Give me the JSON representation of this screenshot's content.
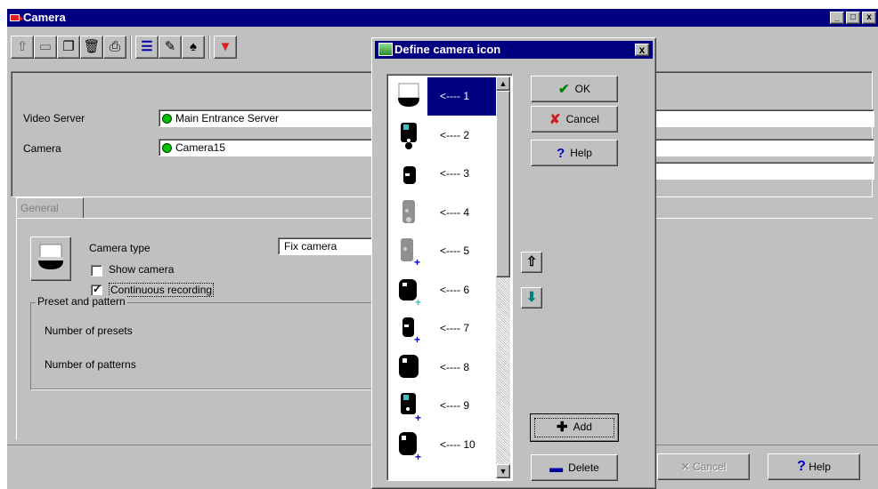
{
  "main_window": {
    "title": "Camera",
    "window_controls": [
      "_",
      "□",
      "x"
    ],
    "toolbar_icons": [
      "up-arrow-icon",
      "save-icon",
      "copy-icon",
      "delete-icon",
      "print-icon",
      "list-icon",
      "pen-icon",
      "binoculars-icon",
      "tool-icon"
    ],
    "video_server_label": "Video Server",
    "video_server_value": "Main Entrance Server",
    "camera_label": "Camera",
    "camera_value": "Camera15",
    "tab_general": "General",
    "camera_type_label": "Camera type",
    "camera_type_value": "Fix camera",
    "show_camera_label": "Show camera",
    "show_camera_checked": false,
    "continuous_recording_label": "Continuous recording",
    "continuous_recording_checked": true,
    "preset_group_title": "Preset and pattern",
    "presets_label": "Number of presets",
    "patterns_label": "Number of patterns",
    "cancel_label": "Cancel",
    "help_label": "Help"
  },
  "dialog": {
    "title": "Define camera icon",
    "close_glyph": "x",
    "selected_index": 0,
    "items": [
      {
        "label": "<---- 1",
        "icon": "dome-camera-icon"
      },
      {
        "label": "<---- 2",
        "icon": "box-camera-icon"
      },
      {
        "label": "<---- 3",
        "icon": "small-camera-icon"
      },
      {
        "label": "<---- 4",
        "icon": "grey-camera-icon"
      },
      {
        "label": "<---- 5",
        "icon": "grey-camera-plus-icon"
      },
      {
        "label": "<---- 6",
        "icon": "camera-plus-icon"
      },
      {
        "label": "<---- 7",
        "icon": "small-camera-plus-icon"
      },
      {
        "label": "<---- 8",
        "icon": "large-camera-icon"
      },
      {
        "label": "<---- 9",
        "icon": "box-camera-plus-icon"
      },
      {
        "label": "<---- 10",
        "icon": "large-camera-plus-icon"
      }
    ],
    "ok_label": "OK",
    "cancel_label": "Cancel",
    "help_label": "Help",
    "add_label": "Add",
    "delete_label": "Delete"
  },
  "colors": {
    "title_bar": "#000080",
    "face": "#c0c0c0",
    "status_green": "#00c000",
    "ok_check": "#008000",
    "cancel_x": "#cc2020",
    "help_mark": "#0000c0",
    "move_arrow": "#008080"
  }
}
